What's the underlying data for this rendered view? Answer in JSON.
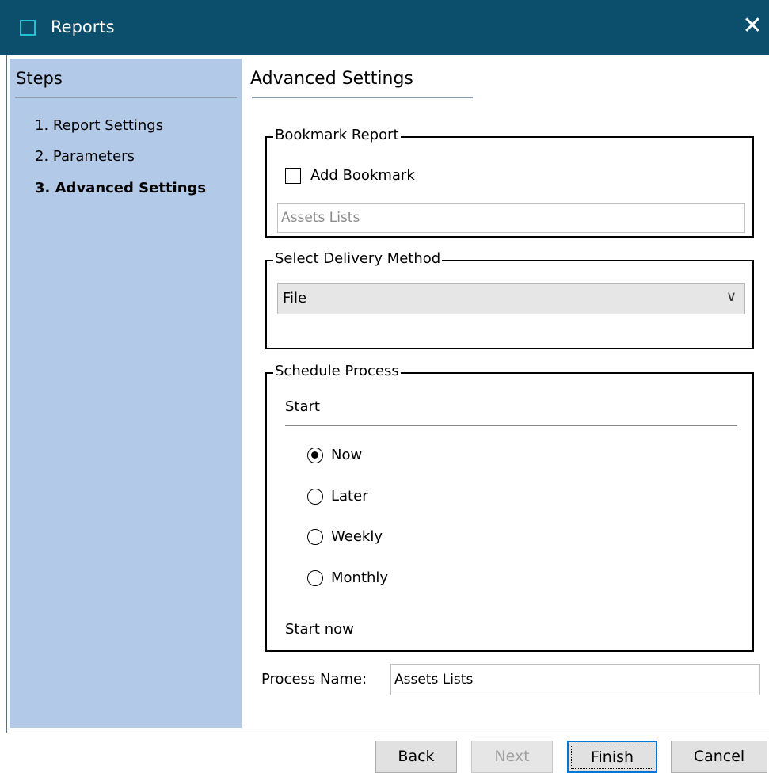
{
  "window": {
    "title": "Reports",
    "close_icon": "close-icon"
  },
  "sidebar": {
    "title": "Steps",
    "steps": [
      {
        "label": "1. Report Settings",
        "current": false
      },
      {
        "label": "2. Parameters",
        "current": false
      },
      {
        "label": "3. Advanced Settings",
        "current": true
      }
    ]
  },
  "main": {
    "title": "Advanced Settings",
    "bookmark": {
      "legend": "Bookmark Report",
      "checkbox_label": "Add Bookmark",
      "checked": false,
      "input_placeholder": "Assets Lists"
    },
    "delivery": {
      "legend": "Select Delivery Method",
      "selected": "File"
    },
    "schedule": {
      "legend": "Schedule Process",
      "start_label": "Start",
      "options": [
        "Now",
        "Later",
        "Weekly",
        "Monthly"
      ],
      "selected": "Now",
      "status": "Start now"
    },
    "process_name": {
      "label": "Process Name:",
      "value": "Assets Lists"
    }
  },
  "buttons": {
    "back": "Back",
    "next": "Next",
    "finish": "Finish",
    "cancel": "Cancel"
  },
  "colors": {
    "titlebar": "#0b4f6c",
    "sidebar": "#b3c9e8",
    "accent": "#0078d7"
  }
}
